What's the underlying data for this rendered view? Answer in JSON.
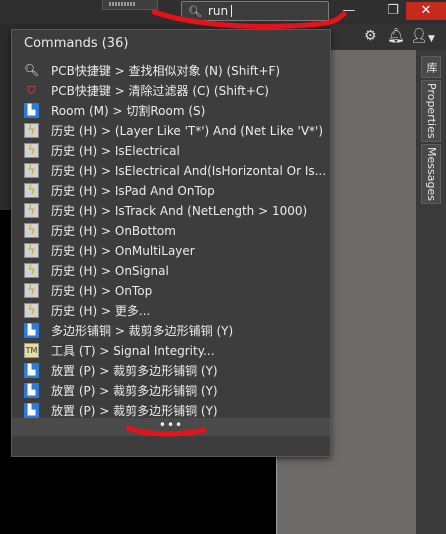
{
  "search": {
    "value": "run"
  },
  "window": {
    "minimize_glyph": "—",
    "restore_glyph": "❐",
    "close_glyph": "✕"
  },
  "side_tabs": [
    "库",
    "Properties",
    "Messages"
  ],
  "panel": {
    "title": "Commands (36)",
    "more_label": "•••",
    "items": [
      {
        "icon": "search-icon",
        "label": "PCB快捷键 > 查找相似对象 (N) (Shift+F)"
      },
      {
        "icon": "filter-clear-icon",
        "label": "PCB快捷键 > 清除过滤器 (C) (Shift+C)"
      },
      {
        "icon": "room-icon",
        "label": "Room (M) > 切割Room (S)"
      },
      {
        "icon": "lightning-icon",
        "label": "历史 (H) > (Layer Like 'T*') And (Net Like 'V*')"
      },
      {
        "icon": "lightning-icon",
        "label": "历史 (H) > IsElectrical"
      },
      {
        "icon": "lightning-icon",
        "label": "历史 (H) > IsElectrical And(IsHorizontal Or Is..."
      },
      {
        "icon": "lightning-icon",
        "label": "历史 (H) > IsPad And OnTop"
      },
      {
        "icon": "lightning-icon",
        "label": "历史 (H) > IsTrack And (NetLength > 1000)"
      },
      {
        "icon": "lightning-icon",
        "label": "历史 (H) > OnBottom"
      },
      {
        "icon": "lightning-icon",
        "label": "历史 (H) > OnMultiLayer"
      },
      {
        "icon": "lightning-icon",
        "label": "历史 (H) > OnSignal"
      },
      {
        "icon": "lightning-icon",
        "label": "历史 (H) > OnTop"
      },
      {
        "icon": "lightning-icon",
        "label": "历史 (H) > 更多..."
      },
      {
        "icon": "polygon-icon",
        "label": "多边形铺铜 > 裁剪多边形铺铜 (Y)"
      },
      {
        "icon": "tools-icon",
        "label": "工具 (T) > Signal Integrity..."
      },
      {
        "icon": "polygon-icon",
        "label": "放置 (P) > 裁剪多边形铺铜 (Y)"
      },
      {
        "icon": "polygon-icon",
        "label": "放置 (P) > 裁剪多边形铺铜 (Y)"
      },
      {
        "icon": "polygon-icon",
        "label": "放置 (P) > 裁剪多边形铺铜 (Y)"
      }
    ]
  },
  "colors": {
    "annotation": "#e8101a",
    "panel_bg": "#3d3d3d",
    "close_red": "#c42b1c"
  }
}
